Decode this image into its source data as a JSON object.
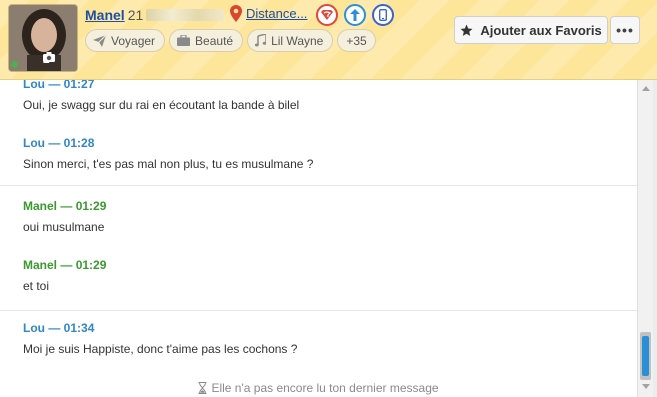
{
  "profile": {
    "name": "Manel",
    "age_partial": "21",
    "distance_label": "Distance...",
    "photo_count": "2",
    "interests": [
      {
        "label": "Voyager",
        "icon": "paper-plane-icon"
      },
      {
        "label": "Beauté",
        "icon": "briefcase-icon"
      },
      {
        "label": "Lil Wayne",
        "icon": "music-note-icon"
      },
      {
        "label": "+35",
        "icon": ""
      }
    ]
  },
  "header": {
    "favorite_label": "Ajouter aux Favoris",
    "more_label": "•••",
    "icons": [
      "location-pin-icon",
      "superman-badge-icon",
      "boost-arrow-icon",
      "mobile-phone-icon",
      "star-icon"
    ]
  },
  "colors": {
    "header_bg": "#fde59a",
    "lou": "#2f86c9",
    "manel": "#3a9a2e",
    "link": "#1f4fa3"
  },
  "messages": [
    {
      "author": "Lou",
      "time": "01:27",
      "text": "Oui, je swagg sur du rai en écoutant la bande à bilel"
    },
    {
      "author": "Lou",
      "time": "01:28",
      "text": "Sinon merci, t'es pas mal non plus, tu es musulmane ?"
    },
    {
      "author": "Manel",
      "time": "01:29",
      "text": "oui musulmane"
    },
    {
      "author": "Manel",
      "time": "01:29",
      "text": "et toi"
    },
    {
      "author": "Lou",
      "time": "01:34",
      "text": "Moi je suis Happiste, donc t'aime pas les cochons ?"
    }
  ],
  "status": {
    "text": "Elle n'a pas encore lu ton dernier message",
    "icon": "hourglass-icon"
  }
}
